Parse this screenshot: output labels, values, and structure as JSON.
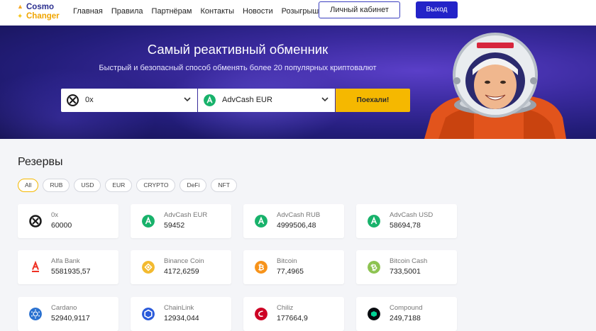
{
  "logo": {
    "line1": "Cosmo",
    "line2": "Changer"
  },
  "nav": [
    {
      "label": "Главная"
    },
    {
      "label": "Правила"
    },
    {
      "label": "Партнёрам"
    },
    {
      "label": "Контакты"
    },
    {
      "label": "Новости"
    },
    {
      "label": "Розыгрыш"
    }
  ],
  "header": {
    "cabinet_label": "Личный кабинет",
    "logout_label": "Выход"
  },
  "hero": {
    "title": "Самый реактивный обменник",
    "subtitle": "Быстрый и безопасный способ обменять более 20 популярных криптовалют",
    "from_currency": "0x",
    "to_currency": "AdvCash EUR",
    "go_label": "Поехали!"
  },
  "reserves": {
    "title": "Резервы",
    "filters": [
      "All",
      "RUB",
      "USD",
      "EUR",
      "CRYPTO",
      "DeFi",
      "NFT"
    ],
    "active_filter": "All",
    "items": [
      {
        "name": "0x",
        "value": "60000",
        "icon": "0x-icon",
        "color": "#1a1a1a"
      },
      {
        "name": "AdvCash EUR",
        "value": "59452",
        "icon": "advcash-icon",
        "color": "#18b26b"
      },
      {
        "name": "AdvCash RUB",
        "value": "4999506,48",
        "icon": "advcash-icon",
        "color": "#18b26b"
      },
      {
        "name": "AdvCash USD",
        "value": "58694,78",
        "icon": "advcash-icon",
        "color": "#18b26b"
      },
      {
        "name": "Alfa Bank",
        "value": "5581935,57",
        "icon": "alfa-bank-icon",
        "color": "#ef3124"
      },
      {
        "name": "Binance Coin",
        "value": "4172,6259",
        "icon": "binance-coin-icon",
        "color": "#f3ba2f"
      },
      {
        "name": "Bitcoin",
        "value": "77,4965",
        "icon": "bitcoin-icon",
        "color": "#f7931a"
      },
      {
        "name": "Bitcoin Cash",
        "value": "733,5001",
        "icon": "bitcoin-cash-icon",
        "color": "#8dc351"
      },
      {
        "name": "Cardano",
        "value": "52940,9117",
        "icon": "cardano-icon",
        "color": "#2a71d0"
      },
      {
        "name": "ChainLink",
        "value": "12934,044",
        "icon": "chainlink-icon",
        "color": "#2a5ada"
      },
      {
        "name": "Chiliz",
        "value": "177664,9",
        "icon": "chiliz-icon",
        "color": "#cd0124"
      },
      {
        "name": "Compound",
        "value": "249,7188",
        "icon": "compound-icon",
        "color": "#070a0e"
      }
    ]
  },
  "colors": {
    "accent_yellow": "#f5b800",
    "brand_blue": "#2323c8",
    "hero_bg": "#2a2288"
  }
}
